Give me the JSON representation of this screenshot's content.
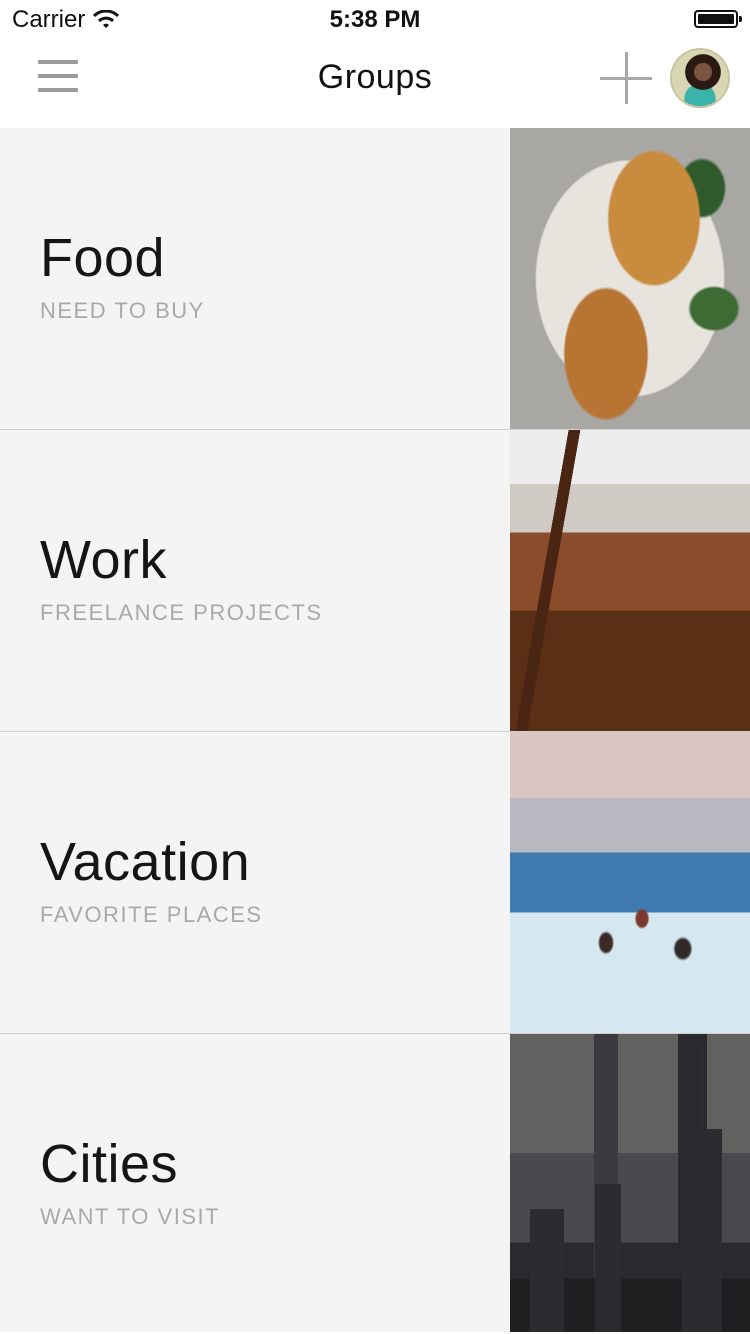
{
  "status_bar": {
    "carrier": "Carrier",
    "time": "5:38 PM"
  },
  "nav": {
    "title": "Groups"
  },
  "groups": [
    {
      "title": "Food",
      "subtitle": "NEED TO BUY",
      "image": "toasted-sandwich-photo"
    },
    {
      "title": "Work",
      "subtitle": "FREELANCE PROJECTS",
      "image": "chairs-table-photo"
    },
    {
      "title": "Vacation",
      "subtitle": "FAVORITE PLACES",
      "image": "people-on-cliffs-by-sea-photo"
    },
    {
      "title": "Cities",
      "subtitle": "WANT TO VISIT",
      "image": "city-skyline-photo"
    }
  ],
  "colors": {
    "row_background": "#f4f4f4",
    "divider": "#cfcfcf",
    "title_text": "#151515",
    "subtitle_text": "#a9a9a9",
    "icon_gray": "#9a9a9a"
  }
}
